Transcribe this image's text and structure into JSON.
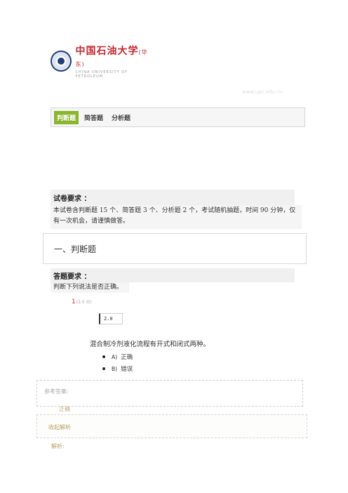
{
  "header": {
    "logo_cn": "中国石油大学",
    "logo_cn_suffix": "(华东)",
    "logo_en": "CHINA UNIVERSITY OF PETROLEUM",
    "faint_text": "www.upc.edu.cn"
  },
  "tabs": [
    {
      "label": "判断题",
      "active": true
    },
    {
      "label": "简答题",
      "active": false
    },
    {
      "label": "分析题",
      "active": false
    }
  ],
  "exam_requirements": {
    "title": "试卷要求 ：",
    "text": "本试卷含判断题 15 个、简答题 3 个、分析题 2 个，考试随机抽题，时间 90 分钟，仅有一次机会，请谨慎做答。"
  },
  "section": {
    "title": "一、判断题"
  },
  "answer_requirements": {
    "title": "答题要求 ：",
    "text": "判断下列说法是否正确。"
  },
  "question": {
    "number": "1",
    "points": "(2.0 分)",
    "score_value": "2.0",
    "text": "混合制冷剂液化流程有开式和闭式两种。",
    "options": [
      {
        "letter": "A)",
        "text": "正确"
      },
      {
        "letter": "B)",
        "text": "错误"
      }
    ]
  },
  "reference": {
    "label": "参考答案:",
    "answer": "正确"
  },
  "collapse_label": "收起解析",
  "analysis_label": "解析:"
}
